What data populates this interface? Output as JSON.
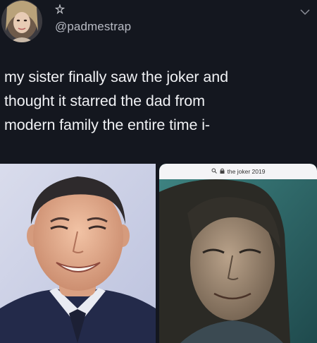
{
  "user": {
    "handle": "@padmestrap",
    "avatar_icon": "avatar-portrait",
    "badge_icon": "sparkle-icon"
  },
  "menu_icon": "chevron-down-icon",
  "tweet": {
    "lines": [
      "my sister finally saw the joker and",
      "thought it starred the dad from",
      "modern family the entire time i-"
    ]
  },
  "media": {
    "left_photo": "smiling-man-suit-photo",
    "right_photo": "movie-still-photo",
    "search_query": "the joker 2019",
    "search_icon": "search-icon",
    "lock_icon": "lock-icon"
  },
  "colors": {
    "background": "#14171f",
    "text": "#f0f1f4",
    "muted": "#b8bbc4"
  }
}
